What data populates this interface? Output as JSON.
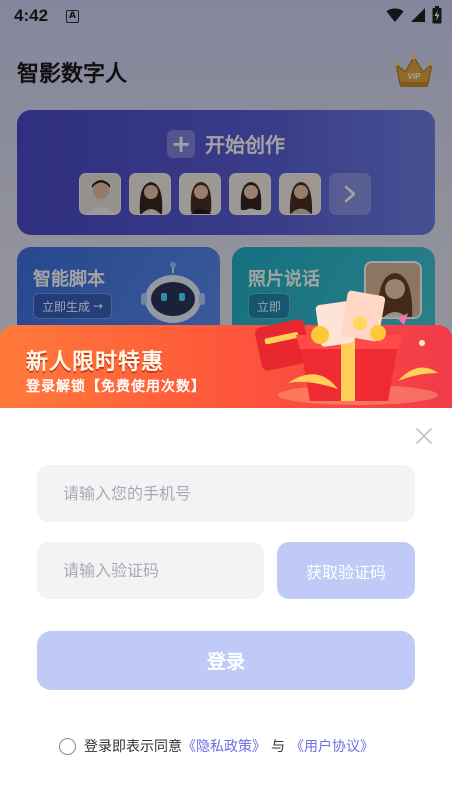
{
  "status_bar": {
    "time": "4:42",
    "notification_glyph": "A"
  },
  "header": {
    "app_title": "智影数字人",
    "vip_icon": "crown-vip-icon"
  },
  "create_card": {
    "label": "开始创作"
  },
  "feature_cards": [
    {
      "title": "智能脚本",
      "button": "立即生成"
    },
    {
      "title": "照片说话",
      "button": "立即"
    }
  ],
  "promo": {
    "title": "新人限时特惠",
    "subtitle": "登录解锁【免费使用次数】"
  },
  "login": {
    "phone_placeholder": "请输入您的手机号",
    "code_placeholder": "请输入验证码",
    "get_code_label": "获取验证码",
    "login_label": "登录",
    "agree_prefix": "登录即表示同意",
    "privacy_link": "《隐私政策》",
    "and_text": "与",
    "terms_link": "《用户协议》"
  },
  "colors": {
    "accent_light": "#bfcaf7",
    "link": "#6a6fe0",
    "promo_start": "#ff7a3a",
    "promo_end": "#f23a4a"
  }
}
